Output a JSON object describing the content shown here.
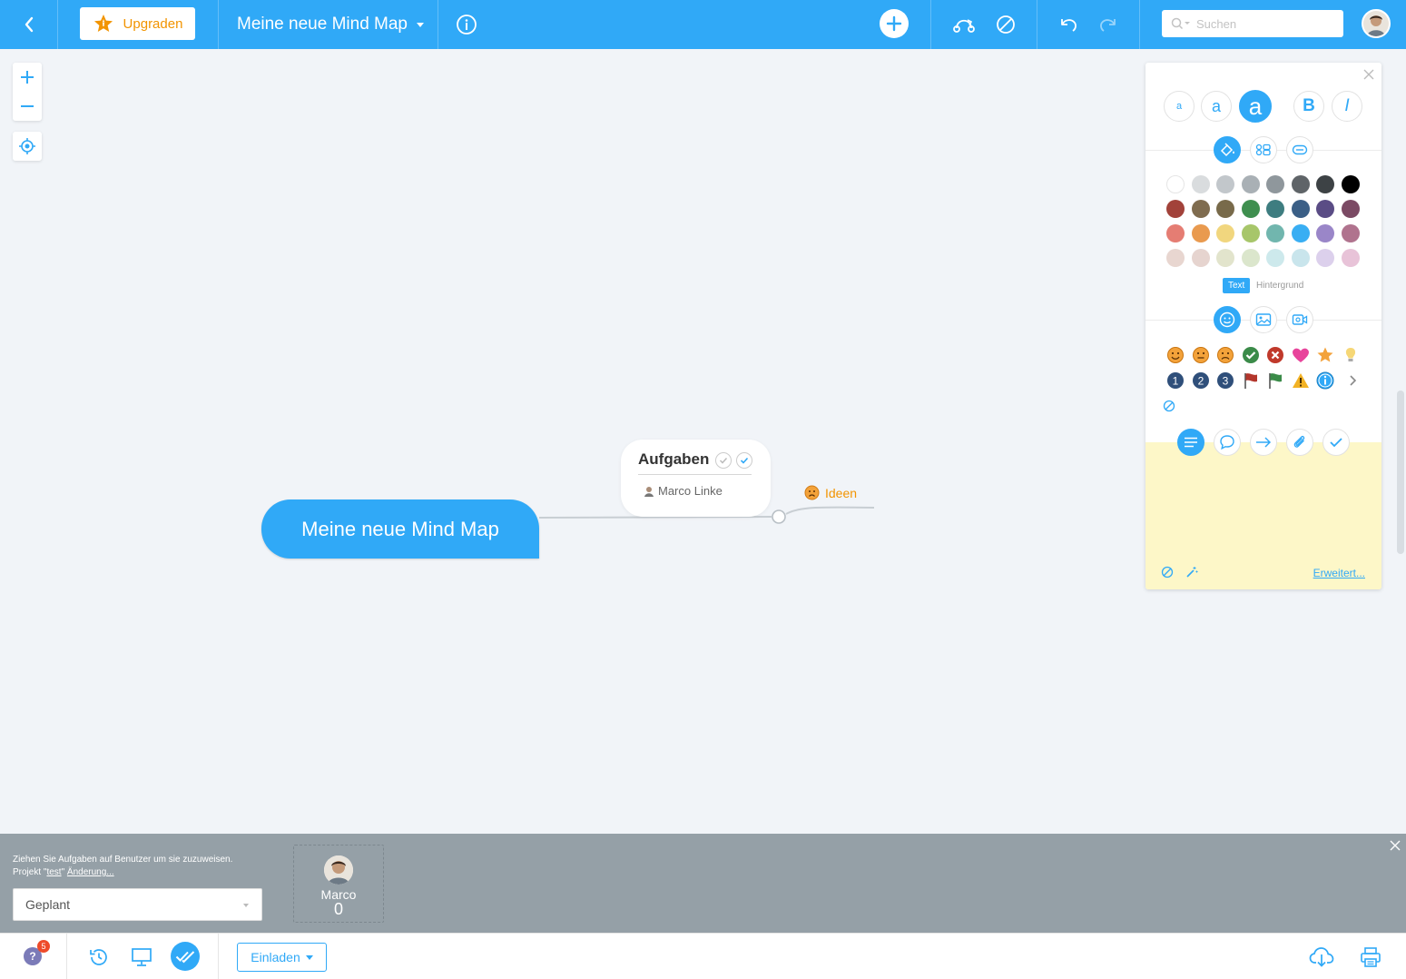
{
  "topbar": {
    "upgrade_label": "Upgraden",
    "map_title": "Meine neue Mind Map",
    "search_placeholder": "Suchen"
  },
  "map": {
    "root_label": "Meine neue Mind Map",
    "task_node": {
      "title": "Aufgaben",
      "assignee": "Marco Linke"
    },
    "ideas_label": "Ideen"
  },
  "panel": {
    "font_sizes": [
      "a",
      "a",
      "a"
    ],
    "bold_label": "B",
    "italic_label": "I",
    "color_tab_text": "Text",
    "color_tab_background": "Hintergrund",
    "colors": [
      [
        "#ffffff",
        "#d9dcde",
        "#c2c7cb",
        "#a9b0b5",
        "#8f979c",
        "#5f6468",
        "#3d4245",
        "#000000"
      ],
      [
        "#a2423a",
        "#7f6c4f",
        "#786a4a",
        "#3f8f4f",
        "#3e7d80",
        "#3b5f86",
        "#5a4c85",
        "#7b4a64"
      ],
      [
        "#e57d73",
        "#e99a4f",
        "#f1d67e",
        "#a7c66a",
        "#71b6ae",
        "#39aef3",
        "#9a86c8",
        "#b0738e"
      ],
      [
        "#e8d6d0",
        "#e6d4cf",
        "#e2e4cc",
        "#dbe6cc",
        "#cde9ec",
        "#c9e5ec",
        "#dcd0ec",
        "#e8c3d8"
      ]
    ],
    "advanced_link": "Erweitert..."
  },
  "assign": {
    "hint_line1": "Ziehen Sie Aufgaben auf Benutzer um sie zuzuweisen.",
    "hint_project_prefix": "Projekt \"",
    "hint_project_name": "test",
    "hint_project_suffix": "\"",
    "hint_change": "Änderung...",
    "status_value": "Geplant",
    "user_name": "Marco",
    "user_count": "0"
  },
  "bottombar": {
    "notification_count": "5",
    "invite_label": "Einladen"
  },
  "accent_color": "#30a9f7"
}
